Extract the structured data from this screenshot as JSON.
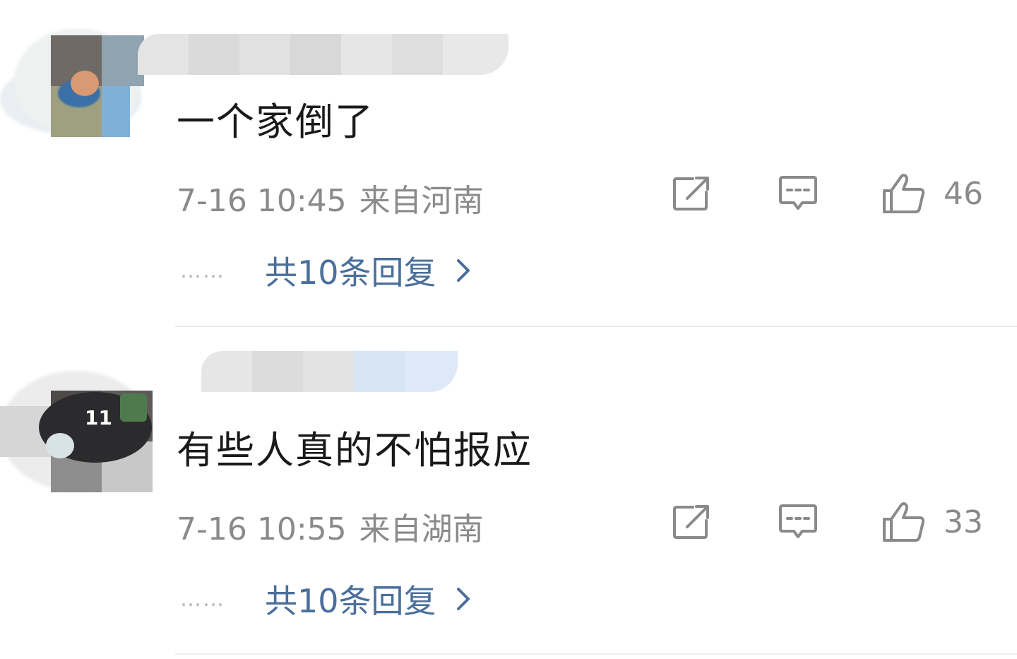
{
  "colors": {
    "text_primary": "#1a1a1a",
    "text_secondary": "#8a8a8a",
    "link": "#4a6f9b",
    "divider": "#ececec",
    "icon": "#8a8a8a"
  },
  "comments": [
    {
      "text": "一个家倒了",
      "time": "7-16 10:45",
      "location": "来自河南",
      "likes": "46",
      "replies_dots": "……",
      "replies_label": "共10条回复",
      "icons": [
        "share-icon",
        "comment-icon",
        "thumbs-up-icon",
        "chevron-right-icon"
      ]
    },
    {
      "text": "有些人真的不怕报应",
      "time": "7-16 10:55",
      "location": "来自湖南",
      "likes": "33",
      "replies_dots": "……",
      "replies_label": "共10条回复",
      "icons": [
        "share-icon",
        "comment-icon",
        "thumbs-up-icon",
        "chevron-right-icon"
      ]
    }
  ]
}
